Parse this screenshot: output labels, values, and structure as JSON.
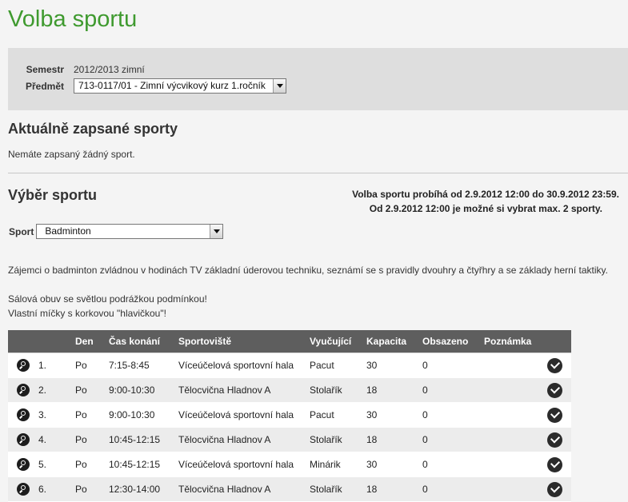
{
  "page": {
    "title": "Volba sportu"
  },
  "filter": {
    "semestr_label": "Semestr",
    "semestr_value": "2012/2013 zimní",
    "predmet_label": "Předmět",
    "predmet_value": "713-0117/01 - Zimní výcvikový kurz 1.ročník"
  },
  "current": {
    "heading": "Aktuálně zapsané sporty",
    "empty_text": "Nemáte zapsaný žádný sport."
  },
  "selection": {
    "heading": "Výběr sportu",
    "notice_line1": "Volba sportu probíhá od 2.9.2012 12:00 do 30.9.2012 23:59.",
    "notice_line2": "Od 2.9.2012 12:00 je možné si vybrat max. 2 sporty.",
    "sport_label": "Sport",
    "sport_value": "Badminton",
    "description": "Zájemci o badminton zvládnou v hodinách TV základní úderovou techniku, seznámí se s pravidly dvouhry a čtyřhry a se základy herní taktiky.",
    "note_line1": "Sálová obuv se světlou podrážkou podmínkou!",
    "note_line2": "Vlastní míčky s korkovou \"hlavičkou\"!"
  },
  "table": {
    "headers": {
      "den": "Den",
      "cas": "Čas konání",
      "sportoviste": "Sportoviště",
      "vyucujici": "Vyučující",
      "kapacita": "Kapacita",
      "obsazeno": "Obsazeno",
      "poznamka": "Poznámka"
    },
    "rows": [
      {
        "num": "1.",
        "den": "Po",
        "cas": "7:15-8:45",
        "sportoviste": "Víceúčelová sportovní hala",
        "vyucujici": "Pacut",
        "kapacita": "30",
        "obsazeno": "0",
        "poznamka": ""
      },
      {
        "num": "2.",
        "den": "Po",
        "cas": "9:00-10:30",
        "sportoviste": "Tělocvična Hladnov A",
        "vyucujici": "Stolařík",
        "kapacita": "18",
        "obsazeno": "0",
        "poznamka": ""
      },
      {
        "num": "3.",
        "den": "Po",
        "cas": "9:00-10:30",
        "sportoviste": "Víceúčelová sportovní hala",
        "vyucujici": "Pacut",
        "kapacita": "30",
        "obsazeno": "0",
        "poznamka": ""
      },
      {
        "num": "4.",
        "den": "Po",
        "cas": "10:45-12:15",
        "sportoviste": "Tělocvična Hladnov A",
        "vyucujici": "Stolařík",
        "kapacita": "18",
        "obsazeno": "0",
        "poznamka": ""
      },
      {
        "num": "5.",
        "den": "Po",
        "cas": "10:45-12:15",
        "sportoviste": "Víceúčelová sportovní hala",
        "vyucujici": "Minárik",
        "kapacita": "30",
        "obsazeno": "0",
        "poznamka": ""
      },
      {
        "num": "6.",
        "den": "Po",
        "cas": "12:30-14:00",
        "sportoviste": "Tělocvična Hladnov A",
        "vyucujici": "Stolařík",
        "kapacita": "18",
        "obsazeno": "0",
        "poznamka": ""
      }
    ]
  },
  "icons": {
    "detail": "magnifier-icon",
    "select": "check-circle-icon"
  },
  "colors": {
    "title": "#3f9a2f",
    "table_header": "#5e5e5e",
    "filter_bg": "#dedede"
  }
}
